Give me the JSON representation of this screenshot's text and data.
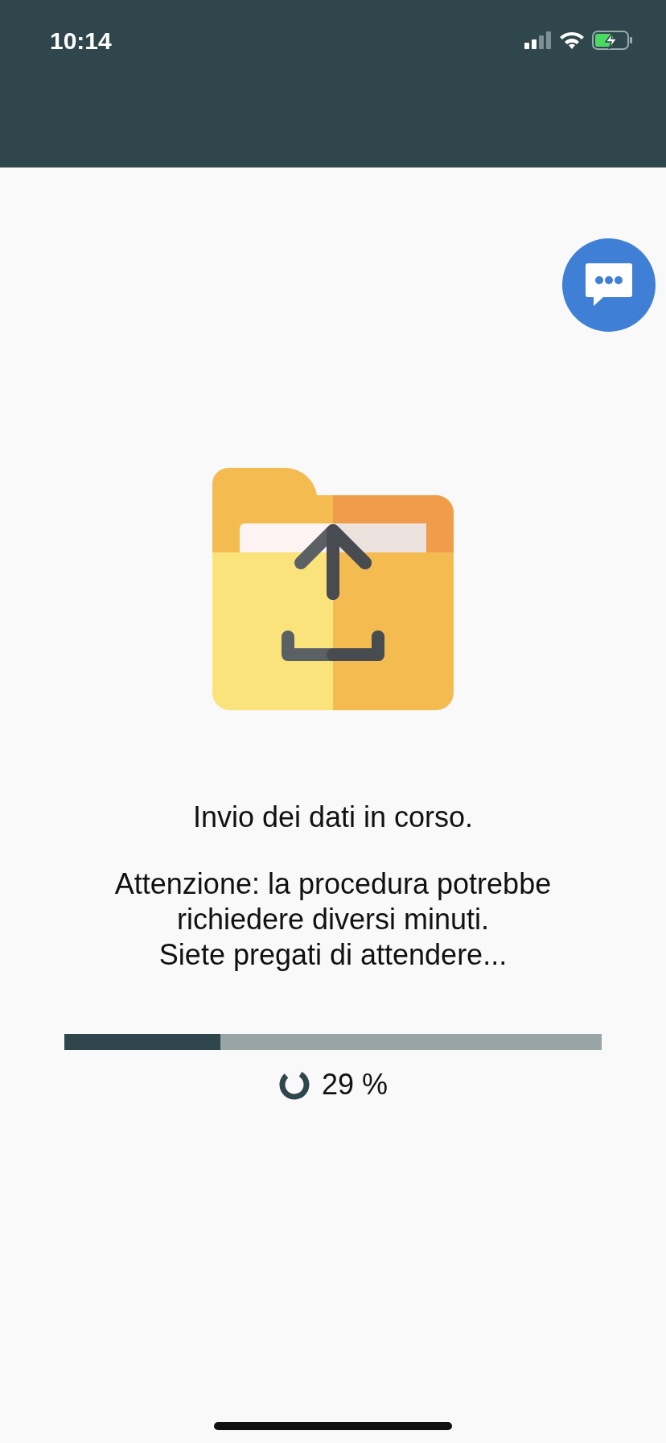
{
  "status_bar": {
    "time": "10:14",
    "charging": true
  },
  "message": {
    "title": "Invio dei dati in corso.",
    "notice_lines": [
      "Attenzione: la procedura potrebbe",
      "richiedere diversi minuti.",
      "Siete pregati di attendere..."
    ]
  },
  "progress": {
    "level": 0.29,
    "reading": "29 %"
  }
}
